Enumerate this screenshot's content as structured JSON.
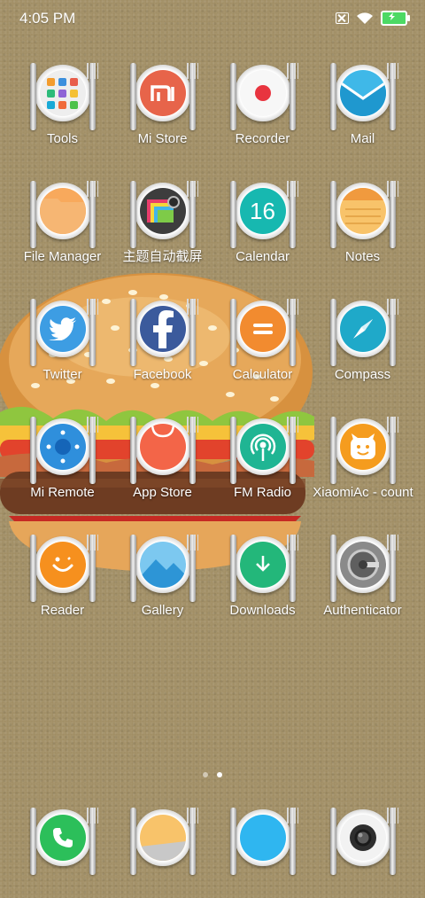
{
  "status_bar": {
    "time": "4:05 PM",
    "icons": [
      "no-sim-icon",
      "wifi-icon",
      "battery-charging-icon"
    ]
  },
  "page_indicator": {
    "pages": 2,
    "current": 2
  },
  "apps": [
    {
      "id": "tools",
      "label": "Tools",
      "icon": "tools-folder-icon"
    },
    {
      "id": "mi-store",
      "label": "Mi Store",
      "icon": "mi-store-icon"
    },
    {
      "id": "recorder",
      "label": "Recorder",
      "icon": "recorder-icon"
    },
    {
      "id": "mail",
      "label": "Mail",
      "icon": "mail-icon"
    },
    {
      "id": "file-manager",
      "label": "File Manager",
      "icon": "folder-icon"
    },
    {
      "id": "theme-screenshot",
      "label": "主题自动截屏",
      "icon": "theme-screenshot-icon"
    },
    {
      "id": "calendar",
      "label": "Calendar",
      "icon": "calendar-icon",
      "day": "16"
    },
    {
      "id": "notes",
      "label": "Notes",
      "icon": "notes-icon"
    },
    {
      "id": "twitter",
      "label": "Twitter",
      "icon": "twitter-icon"
    },
    {
      "id": "facebook",
      "label": "Facebook",
      "icon": "facebook-icon"
    },
    {
      "id": "calculator",
      "label": "Calculator",
      "icon": "calculator-icon"
    },
    {
      "id": "compass",
      "label": "Compass",
      "icon": "compass-icon"
    },
    {
      "id": "mi-remote",
      "label": "Mi Remote",
      "icon": "remote-icon"
    },
    {
      "id": "app-store",
      "label": "App Store",
      "icon": "shopping-bag-icon"
    },
    {
      "id": "fm-radio",
      "label": "FM Radio",
      "icon": "radio-icon"
    },
    {
      "id": "xiaomi-account",
      "label": "XiaomiAc - count",
      "icon": "xiaomi-account-icon"
    },
    {
      "id": "reader",
      "label": "Reader",
      "icon": "reader-icon"
    },
    {
      "id": "gallery",
      "label": "Gallery",
      "icon": "gallery-icon"
    },
    {
      "id": "downloads",
      "label": "Downloads",
      "icon": "download-icon"
    },
    {
      "id": "authenticator",
      "label": "Authenticator",
      "icon": "authenticator-icon"
    }
  ],
  "dock": [
    {
      "id": "phone",
      "icon": "phone-icon"
    },
    {
      "id": "notes-dock",
      "icon": "notes-icon"
    },
    {
      "id": "browser",
      "icon": "browser-icon"
    },
    {
      "id": "camera",
      "icon": "camera-icon"
    }
  ],
  "colors": {
    "wallpaper": "#a08d63",
    "mi_store": "#e7644a",
    "recorder_dot": "#e8343f",
    "mail": "#3fb8e8",
    "file_manager": "#f8a95c",
    "calendar": "#17b8b0",
    "notes": "#f8c36a",
    "twitter": "#3d9de3",
    "facebook": "#3b5a9c",
    "calculator": "#f28b2f",
    "compass": "#1fa9c9",
    "mi_remote": "#2f8fdc",
    "app_store": "#f36548",
    "fm_radio": "#1fb593",
    "xiaomi_account": "#f59c1e",
    "reader": "#f6901e",
    "gallery": "#48b2e8",
    "downloads": "#23b77a",
    "authenticator": "#6f6f6f",
    "phone": "#2cbf5a",
    "browser": "#2fb6f0"
  }
}
